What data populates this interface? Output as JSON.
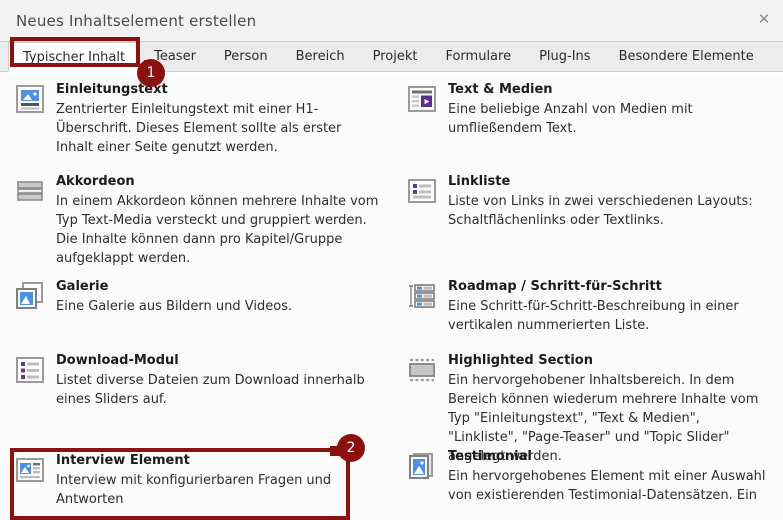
{
  "window": {
    "title": "Neues Inhaltselement erstellen",
    "close_icon": "close-icon",
    "close_glyph": "✕"
  },
  "tabs": [
    {
      "label": "Typischer Inhalt",
      "active": true
    },
    {
      "label": "Teaser",
      "active": false
    },
    {
      "label": "Person",
      "active": false
    },
    {
      "label": "Bereich",
      "active": false
    },
    {
      "label": "Projekt",
      "active": false
    },
    {
      "label": "Formulare",
      "active": false
    },
    {
      "label": "Plug-Ins",
      "active": false
    },
    {
      "label": "Besondere Elemente",
      "active": false
    }
  ],
  "left_column": [
    {
      "icon": "intro-text-icon",
      "title": "Einleitungstext",
      "desc": "Zentrierter Einleitungstext mit einer H1-Überschrift. Dieses Element sollte als erster Inhalt einer Seite genutzt werden."
    },
    {
      "icon": "accordion-icon",
      "title": "Akkordeon",
      "desc": "In einem Akkordeon können mehrere Inhalte vom Typ Text-Media versteckt und gruppiert werden. Die Inhalte können dann pro Kapitel/Gruppe aufgeklappt werden."
    },
    {
      "icon": "gallery-icon",
      "title": "Galerie",
      "desc": "Eine Galerie aus Bildern und Videos."
    },
    {
      "icon": "download-module-icon",
      "title": "Download-Modul",
      "desc": "Listet diverse Dateien zum Download innerhalb eines Sliders auf."
    },
    {
      "icon": "interview-element-icon",
      "title": "Interview Element",
      "desc": "Interview mit konfigurierbaren Fragen und Antworten"
    }
  ],
  "right_column": [
    {
      "icon": "text-media-icon",
      "title": "Text & Medien",
      "desc": "Eine beliebige Anzahl von Medien mit umfließendem Text."
    },
    {
      "icon": "link-list-icon",
      "title": "Linkliste",
      "desc": "Liste von Links in zwei verschiedenen Layouts: Schaltflächenlinks oder Textlinks."
    },
    {
      "icon": "roadmap-icon",
      "title": "Roadmap / Schritt-für-Schritt",
      "desc": "Eine Schritt-für-Schritt-Beschreibung in einer vertikalen nummerierten Liste."
    },
    {
      "icon": "highlighted-section-icon",
      "title": "Highlighted Section",
      "desc": "Ein hervorgehobener Inhaltsbereich. In dem Bereich können wiederum mehrere Inhalte vom Typ \"Einleitungstext\", \"Text & Medien\", \"Linkliste\", \"Page-Teaser\" und \"Topic Slider\" angelegt werden."
    },
    {
      "icon": "testimonial-icon",
      "title": "Testimonial",
      "desc": "Ein hervorgehobenes Element mit einer Auswahl von existierenden Testimonial-Datensätzen. Ein"
    }
  ],
  "annotations": [
    {
      "number": "1",
      "target": "tab-typischer-inhalt"
    },
    {
      "number": "2",
      "target": "item-interview-element"
    }
  ],
  "colors": {
    "annotation_red": "#8c1010",
    "header_bg": "#f2f2f2",
    "tabbar_bg": "#ececec",
    "content_bg": "#fbfbfb"
  }
}
